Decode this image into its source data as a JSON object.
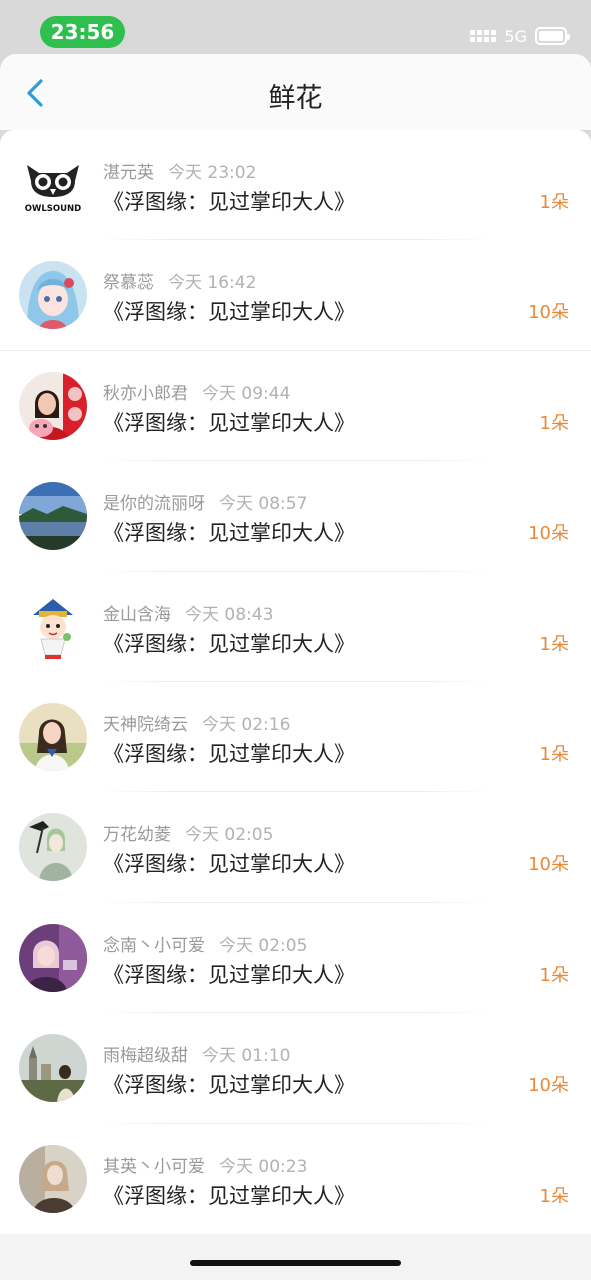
{
  "status_bar": {
    "time": "23:56",
    "network": "5G"
  },
  "header": {
    "title": "鲜花"
  },
  "items": [
    {
      "user": "湛元英",
      "time": "今天 23:02",
      "title": "《浮图缘：见过掌印大人》",
      "count": "1朵"
    },
    {
      "user": "祭慕蕊",
      "time": "今天 16:42",
      "title": "《浮图缘：见过掌印大人》",
      "count": "10朵"
    },
    {
      "user": "秋亦小郎君",
      "time": "今天 09:44",
      "title": "《浮图缘：见过掌印大人》",
      "count": "1朵"
    },
    {
      "user": "是你的流丽呀",
      "time": "今天 08:57",
      "title": "《浮图缘：见过掌印大人》",
      "count": "10朵"
    },
    {
      "user": "金山含海",
      "time": "今天 08:43",
      "title": "《浮图缘：见过掌印大人》",
      "count": "1朵"
    },
    {
      "user": "天神院绮云",
      "time": "今天 02:16",
      "title": "《浮图缘：见过掌印大人》",
      "count": "1朵"
    },
    {
      "user": "万花幼菱",
      "time": "今天 02:05",
      "title": "《浮图缘：见过掌印大人》",
      "count": "10朵"
    },
    {
      "user": "念南丶小可爱",
      "time": "今天 02:05",
      "title": "《浮图缘：见过掌印大人》",
      "count": "1朵"
    },
    {
      "user": "雨梅超级甜",
      "time": "今天 01:10",
      "title": "《浮图缘：见过掌印大人》",
      "count": "10朵"
    },
    {
      "user": "其英丶小可爱",
      "time": "今天 00:23",
      "title": "《浮图缘：见过掌印大人》",
      "count": "1朵"
    }
  ],
  "avatars": [
    {
      "logo_text": "OWLSOUND"
    }
  ],
  "colors": {
    "accent": "#e8893a",
    "status_pill": "#2fbf4f",
    "back_arrow": "#2f9bd8"
  }
}
